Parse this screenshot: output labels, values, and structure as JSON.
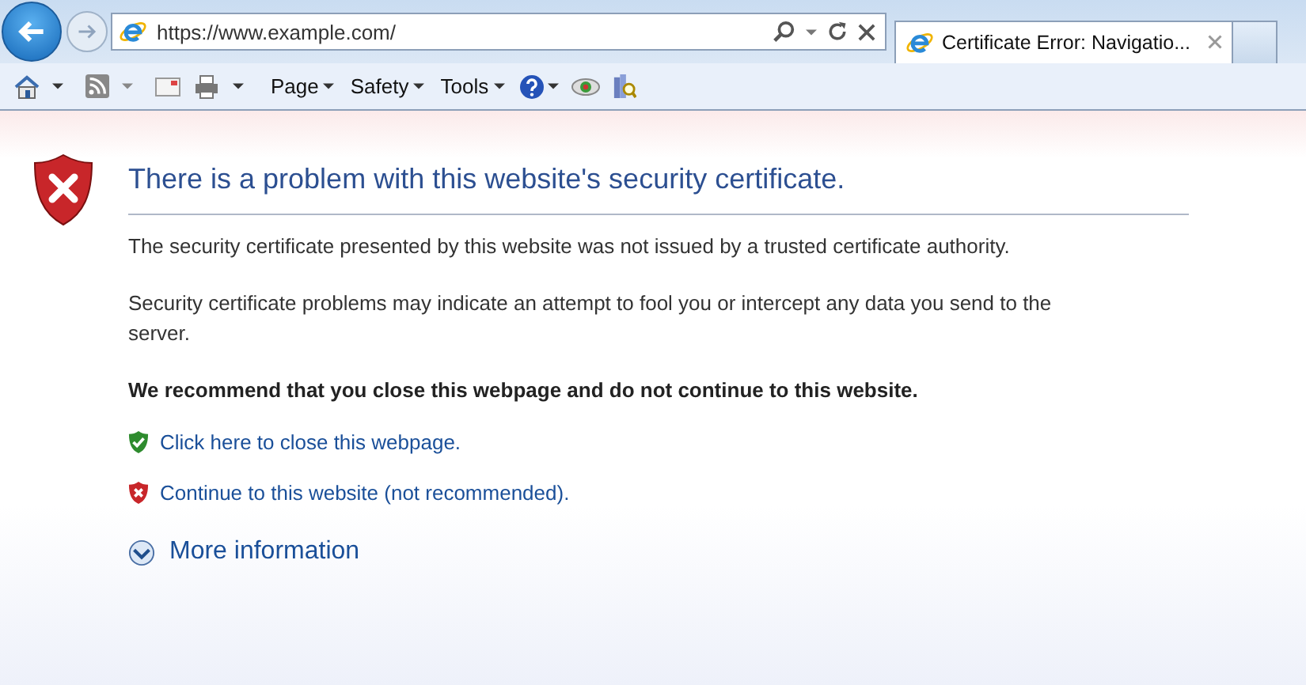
{
  "browser": {
    "address": "https://www.example.com/",
    "tab": {
      "title": "Certificate Error: Navigatio...",
      "selected": true
    }
  },
  "toolbar": {
    "menus": [
      "Page",
      "Safety",
      "Tools"
    ]
  },
  "page": {
    "heading": "There is a problem with this website's security certificate.",
    "paragraphs": [
      "The security certificate presented by this website was not issued by a trusted certificate authority.",
      "Security certificate problems may indicate an attempt to fool you or intercept any data you send to the server."
    ],
    "recommendation": "We recommend that you close this webpage and do not continue to this website.",
    "links": [
      {
        "kind": "safe",
        "label": "Click here to close this webpage."
      },
      {
        "kind": "unsafe",
        "label": "Continue to this website (not recommended)."
      }
    ],
    "more_info": {
      "label": "More information",
      "expanded": false
    }
  }
}
